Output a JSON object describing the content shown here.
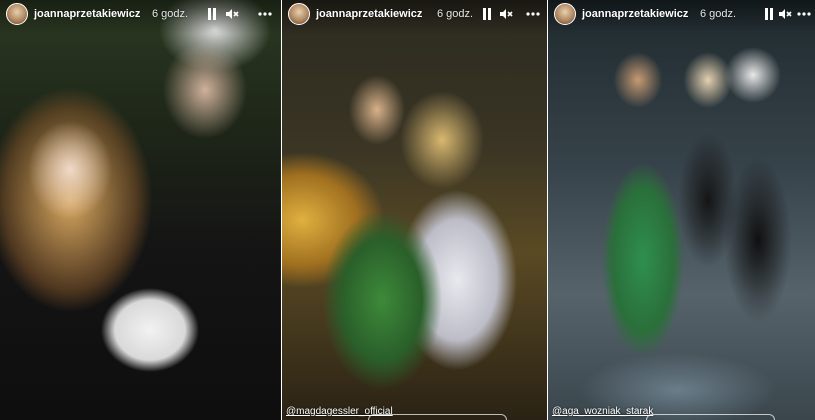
{
  "stories": [
    {
      "username": "joannaprzetakiewicz",
      "time": "6 godz.",
      "mention": ""
    },
    {
      "username": "joannaprzetakiewicz",
      "time": "6 godz.",
      "mention": "@magdagessler_official"
    },
    {
      "username": "joannaprzetakiewicz",
      "time": "6 godz.",
      "mention": "@aga_wozniak_starak"
    }
  ],
  "icons": {
    "pause": "pause-icon",
    "mute": "speaker-muted-icon",
    "more": "more-icon"
  },
  "colors": {
    "text": "#ffffff",
    "separator": "#ffffff"
  }
}
